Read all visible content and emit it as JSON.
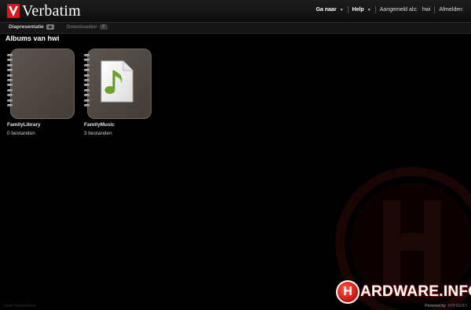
{
  "header": {
    "brand": "Verbatim",
    "nav": {
      "goto_label": "Ga naar",
      "help_label": "Help",
      "logged_in_label": "Aangemeld als:",
      "username": "hwi",
      "logout_label": "Afmelden"
    }
  },
  "toolbar": {
    "slideshow_label": "Diapresentatie",
    "download_label": "Downloaden",
    "download_count": "0"
  },
  "page": {
    "title": "Albums van hwi"
  },
  "albums": [
    {
      "name": "FamilyLibrary",
      "count": "0 bestanden",
      "icon": "empty-album"
    },
    {
      "name": "FamilyMusic",
      "count": "3 bestanden",
      "icon": "music-note-icon"
    }
  ],
  "footer": {
    "left_text": "Cloud MediaShare",
    "powered_by": "Powered by",
    "powered_logo": "HIPSERV",
    "watermark_text": "HARDWARE.INFO"
  },
  "colors": {
    "brand_red": "#d7191a",
    "album_cover": "#4c4540",
    "music_green": "#6aa52b"
  }
}
